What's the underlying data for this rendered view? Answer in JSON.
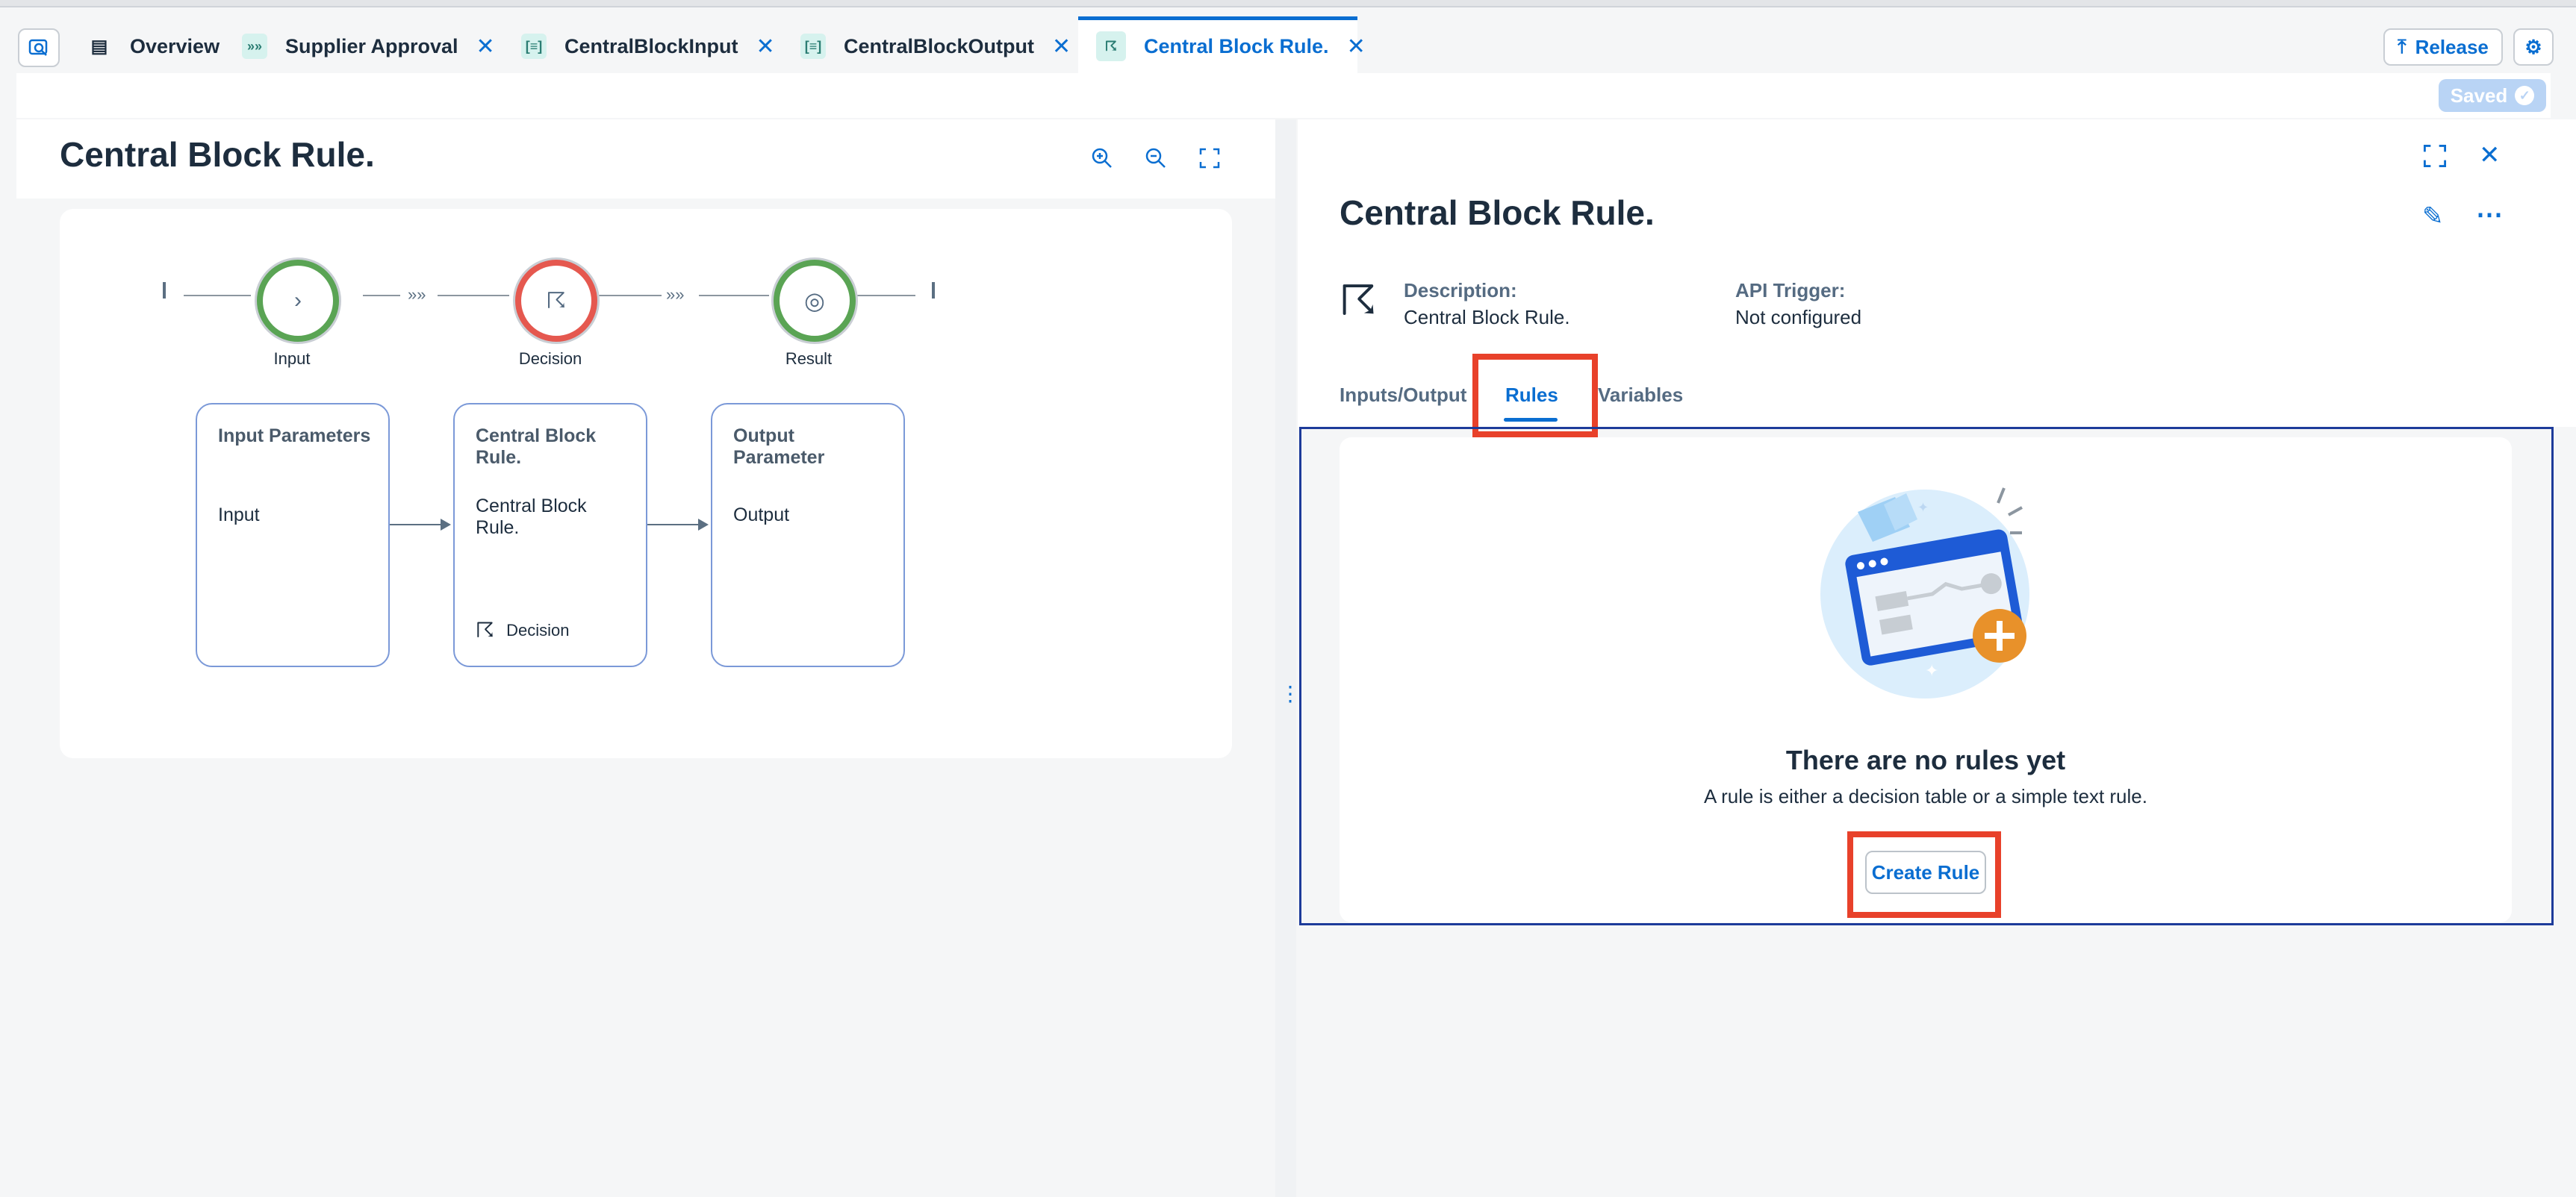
{
  "tabs": [
    {
      "label": "Overview",
      "icon": "overview-icon"
    },
    {
      "label": "Supplier Approval",
      "icon": "process-icon"
    },
    {
      "label": "CentralBlockInput",
      "icon": "datatype-icon"
    },
    {
      "label": "CentralBlockOutput",
      "icon": "datatype-icon"
    },
    {
      "label": "Central Block Rule.",
      "icon": "decision-icon"
    }
  ],
  "header": {
    "release_label": "Release",
    "saved_label": "Saved"
  },
  "left": {
    "title": "Central Block Rule.",
    "nodes": [
      {
        "label": "Input",
        "color": "#5aa454"
      },
      {
        "label": "Decision",
        "color": "#e5584f"
      },
      {
        "label": "Result",
        "color": "#5aa454"
      }
    ],
    "cards": [
      {
        "title": "Input Parameters",
        "value": "Input"
      },
      {
        "title": "Central Block Rule.",
        "value": "Central Block Rule.",
        "footer": "Decision"
      },
      {
        "title": "Output Parameter",
        "value": "Output"
      }
    ]
  },
  "right": {
    "title": "Central Block Rule.",
    "description_label": "Description:",
    "description_value": "Central Block Rule.",
    "api_label": "API Trigger:",
    "api_value": "Not configured",
    "subtabs": [
      "Inputs/Output",
      "Rules",
      "Variables"
    ],
    "empty_title": "There are no rules yet",
    "empty_sub": "A rule is either a decision table or a simple text rule.",
    "create_rule_label": "Create Rule"
  },
  "colors": {
    "accent": "#0a6ed1",
    "highlight": "#e8412a",
    "success": "#5aa454",
    "error": "#e5584f"
  }
}
